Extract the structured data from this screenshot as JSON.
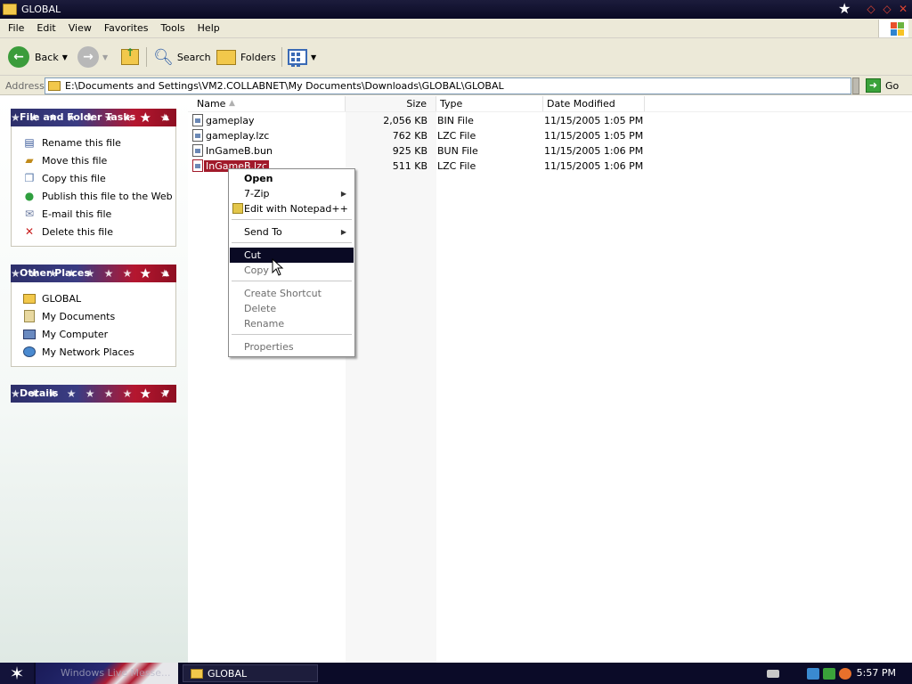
{
  "window": {
    "title": "GLOBAL"
  },
  "menu": [
    "File",
    "Edit",
    "View",
    "Favorites",
    "Tools",
    "Help"
  ],
  "toolbar": {
    "back": "Back",
    "search": "Search",
    "folders": "Folders"
  },
  "address": {
    "label": "Address",
    "path": "E:\\Documents and Settings\\VM2.COLLABNET\\My Documents\\Downloads\\GLOBAL\\GLOBAL",
    "go": "Go"
  },
  "tasks": {
    "title": "File and Folder Tasks",
    "items": [
      "Rename this file",
      "Move this file",
      "Copy this file",
      "Publish this file to the Web",
      "E-mail this file",
      "Delete this file"
    ]
  },
  "places": {
    "title": "Other Places",
    "items": [
      "GLOBAL",
      "My Documents",
      "My Computer",
      "My Network Places"
    ]
  },
  "details": {
    "title": "Details"
  },
  "columns": {
    "name": "Name",
    "size": "Size",
    "type": "Type",
    "date": "Date Modified"
  },
  "files": [
    {
      "name": "gameplay",
      "size": "2,056 KB",
      "type": "BIN File",
      "date": "11/15/2005 1:05 PM"
    },
    {
      "name": "gameplay.lzc",
      "size": "762 KB",
      "type": "LZC File",
      "date": "11/15/2005 1:05 PM"
    },
    {
      "name": "InGameB.bun",
      "size": "925 KB",
      "type": "BUN File",
      "date": "11/15/2005 1:06 PM"
    },
    {
      "name": "InGameB.lzc",
      "size": "511 KB",
      "type": "LZC File",
      "date": "11/15/2005 1:06 PM"
    }
  ],
  "context_menu": {
    "open": "Open",
    "sevenzip": "7-Zip",
    "notepad": "Edit with Notepad++",
    "sendto": "Send To",
    "cut": "Cut",
    "copy": "Copy",
    "shortcut": "Create Shortcut",
    "delete": "Delete",
    "rename": "Rename",
    "properties": "Properties"
  },
  "taskbar": {
    "flag_text": "Windows Live Messe...",
    "task": "GLOBAL",
    "clock": "5:57 PM"
  },
  "colors": {
    "title_bg": "#0a0a24",
    "selection": "#a11a2a",
    "menu_highlight": "#0a0a24",
    "panel_blue": "#2d2f6a",
    "panel_red": "#b5162f"
  }
}
